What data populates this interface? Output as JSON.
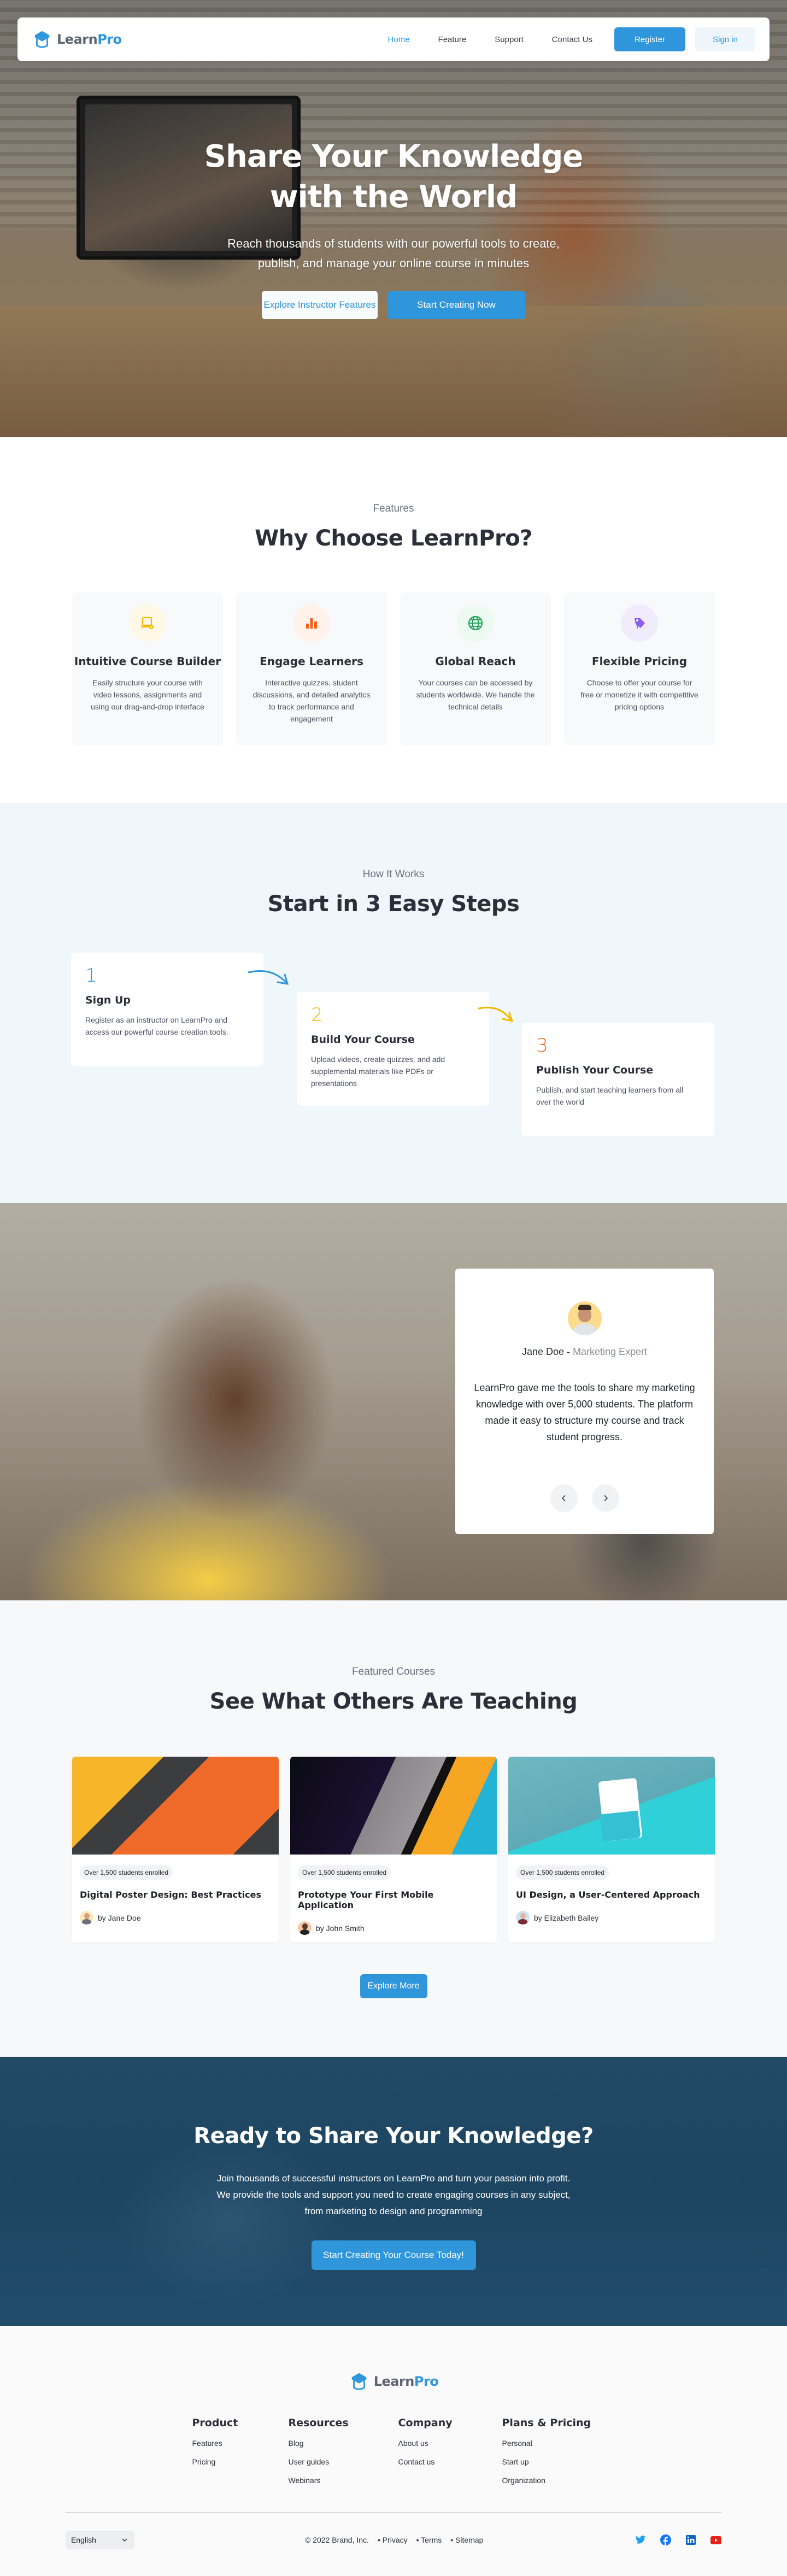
{
  "brand": {
    "learn": "Learn",
    "pro": "Pro"
  },
  "colors": {
    "primary": "#2f96dc",
    "heading": "#2b2f3a",
    "yellow": "#f5b800",
    "orange": "#f2621d",
    "green": "#1fa35a",
    "purple": "#8b5cf6"
  },
  "nav": {
    "links": [
      {
        "label": "Home",
        "active": true
      },
      {
        "label": "Feature"
      },
      {
        "label": "Support"
      },
      {
        "label": "Contact Us"
      }
    ],
    "register": "Register",
    "signin": "Sign in"
  },
  "hero": {
    "title_line1": "Share Your Knowledge",
    "title_line2": "with the World",
    "subtitle_line1": "Reach thousands of students with our powerful tools to create,",
    "subtitle_line2": "publish, and manage your online course in minutes",
    "explore_button": "Explore Instructor Features",
    "start_button": "Start Creating Now"
  },
  "features": {
    "eyebrow": "Features",
    "title": "Why Choose LearnPro?",
    "items": [
      {
        "icon": "laptop-gear-icon",
        "title": "Intuitive Course Builder",
        "desc": "Easily structure your course with video lessons, assignments and using our drag-and-drop interface"
      },
      {
        "icon": "bar-chart-icon",
        "title": "Engage Learners",
        "desc": "Interactive quizzes, student discussions, and detailed analytics to track performance and engagement"
      },
      {
        "icon": "globe-icon",
        "title": "Global Reach",
        "desc": "Your courses can be accessed by students worldwide. We handle the technical details"
      },
      {
        "icon": "price-tag-icon",
        "title": "Flexible Pricing",
        "desc": "Choose to offer your course for free or monetize it with competitive pricing options"
      }
    ]
  },
  "how": {
    "eyebrow": "How It Works",
    "title": "Start in 3 Easy Steps",
    "steps": [
      {
        "num": "1",
        "title": "Sign Up",
        "desc": "Register as an instructor on LearnPro and access our powerful course creation tools."
      },
      {
        "num": "2",
        "title": "Build Your Course",
        "desc": "Upload videos, create quizzes, and add supplemental materials like PDFs or presentations"
      },
      {
        "num": "3",
        "title": "Publish Your Course",
        "desc": "Publish, and start teaching learners from all over the world"
      }
    ]
  },
  "testimonial": {
    "name": "Jane Doe",
    "separator": " - ",
    "role": "Marketing Expert",
    "quote": "LearnPro gave me the tools to share my marketing knowledge with over 5,000 students. The platform made it easy to structure my course and track student progress.",
    "prev_label": "‹",
    "next_label": "›"
  },
  "courses": {
    "eyebrow": "Featured Courses",
    "title": "See What Others Are Teaching",
    "items": [
      {
        "badge": "Over 1,500 students enrolled",
        "title": "Digital Poster Design: Best Practices",
        "author": "by Jane Doe"
      },
      {
        "badge": "Over 1,500 students enrolled",
        "title": "Prototype Your First Mobile Application",
        "author": "by John Smith"
      },
      {
        "badge": "Over 1,500 students enrolled",
        "title": "UI Design, a User-Centered Approach",
        "author": "by Elizabeth Bailey"
      }
    ],
    "explore_more": "Explore More"
  },
  "cta": {
    "title": "Ready to Share Your Knowledge?",
    "text_line1": "Join thousands of successful instructors on LearnPro and turn your passion into profit.",
    "text_line2": "We provide the tools and support you need to create engaging courses in any subject,",
    "text_line3": "from marketing to design and programming",
    "button": "Start Creating Your Course Today!"
  },
  "footer": {
    "columns": [
      {
        "title": "Product",
        "links": [
          "Features",
          "Pricing"
        ]
      },
      {
        "title": "Resources",
        "links": [
          "Blog",
          "User guides",
          "Webinars"
        ]
      },
      {
        "title": "Company",
        "links": [
          "About us",
          "Contact us"
        ]
      },
      {
        "title": "Plans & Pricing",
        "links": [
          "Personal",
          "Start up",
          "Organization"
        ]
      }
    ],
    "language": "English",
    "copyright": "© 2022 Brand, Inc.",
    "legal": [
      "• Privacy",
      "• Terms",
      "• Sitemap"
    ],
    "socials": [
      "twitter",
      "facebook",
      "linkedin",
      "youtube"
    ]
  }
}
